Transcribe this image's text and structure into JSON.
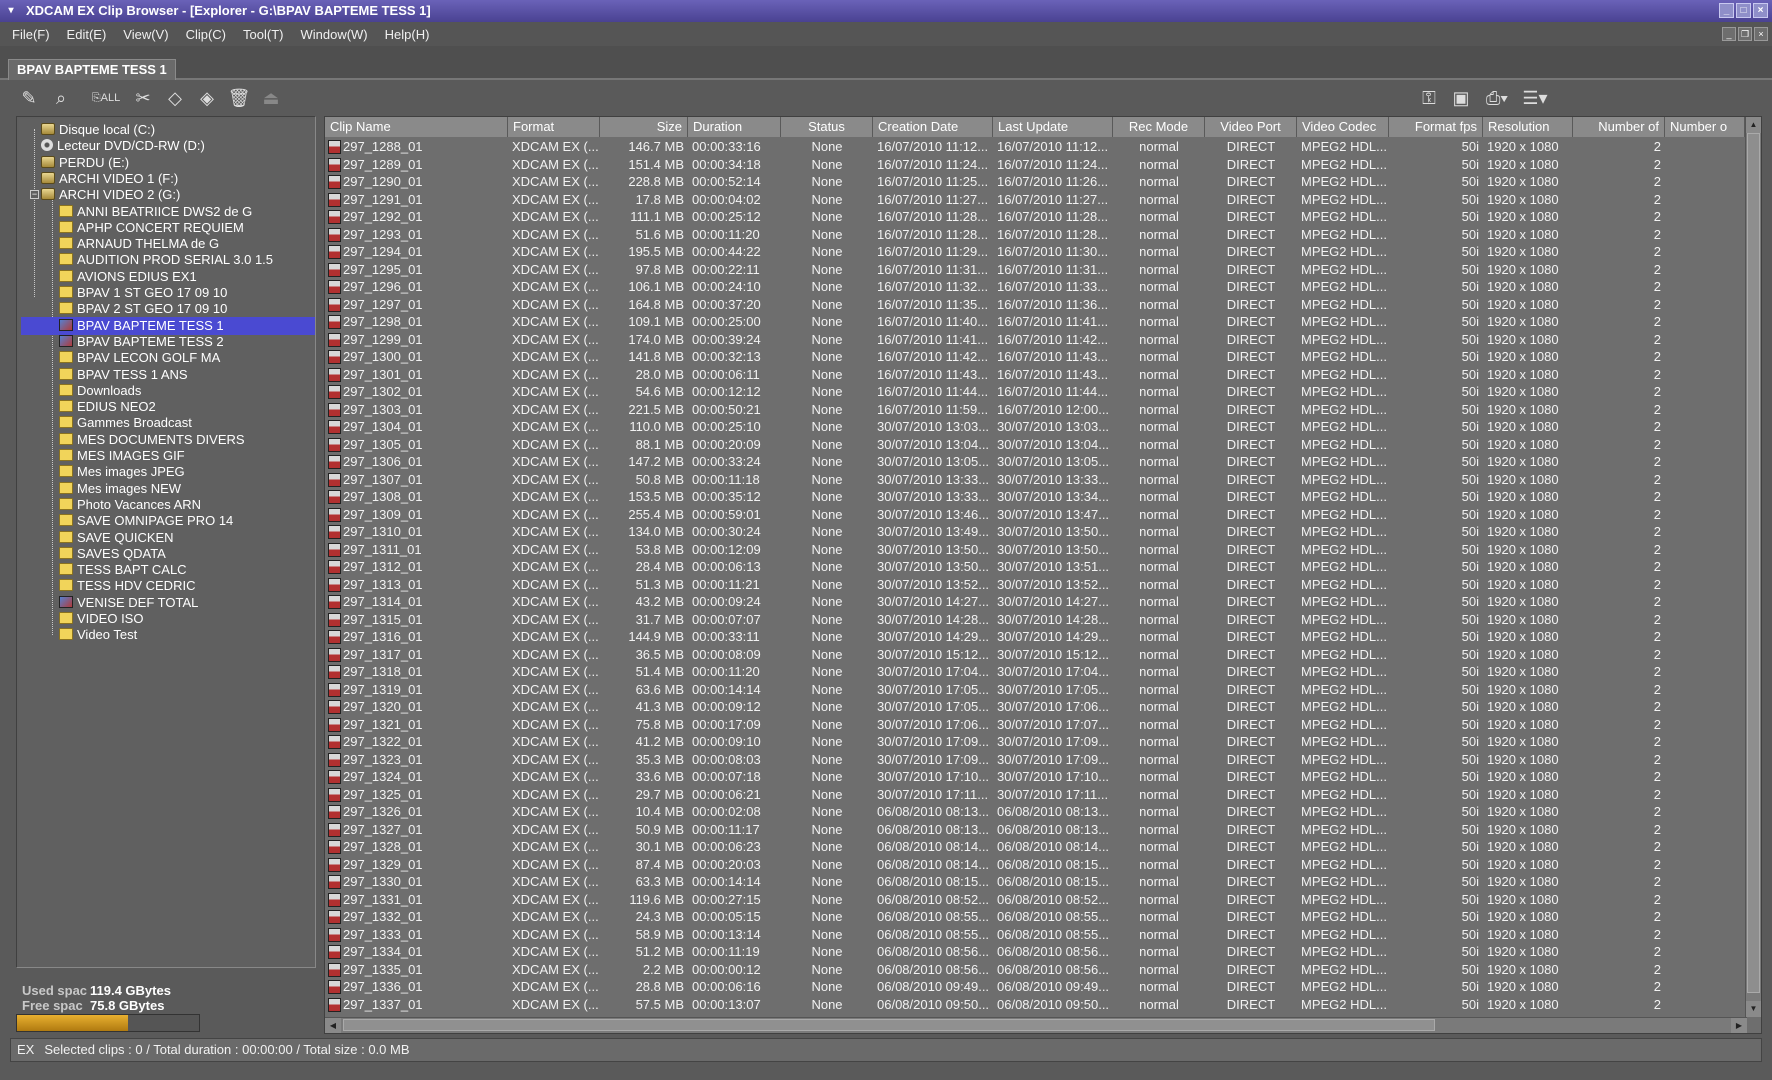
{
  "window": {
    "title": "XDCAM EX Clip Browser - [Explorer - G:\\BPAV BAPTEME TESS 1]"
  },
  "menu": [
    "File(F)",
    "Edit(E)",
    "View(V)",
    "Clip(C)",
    "Tool(T)",
    "Window(W)",
    "Help(H)"
  ],
  "tab": {
    "label": "BPAV BAPTEME TESS 1"
  },
  "tree": [
    {
      "label": "Disque local (C:)",
      "icon": "drive-icon",
      "level": 1
    },
    {
      "label": "Lecteur DVD/CD-RW (D:)",
      "icon": "dvd-icon",
      "level": 1
    },
    {
      "label": "PERDU (E:)",
      "icon": "drive-icon",
      "level": 1
    },
    {
      "label": "ARCHI VIDEO 1 (F:)",
      "icon": "drive-icon",
      "level": 1
    },
    {
      "label": "ARCHI VIDEO 2 (G:)",
      "icon": "drive-icon",
      "level": 1,
      "expanded": true
    },
    {
      "label": "ANNI BEATRIICE DWS2 de G",
      "icon": "folder-icon",
      "level": 2
    },
    {
      "label": "APHP CONCERT REQUIEM",
      "icon": "folder-icon",
      "level": 2
    },
    {
      "label": "ARNAUD THELMA de G",
      "icon": "folder-icon",
      "level": 2
    },
    {
      "label": "AUDITION PROD SERIAL 3.0 1.5",
      "icon": "folder-icon",
      "level": 2
    },
    {
      "label": "AVIONS EDIUS EX1",
      "icon": "folder-icon",
      "level": 2
    },
    {
      "label": "BPAV  1 ST GEO 17 09 10",
      "icon": "folder-icon",
      "level": 2
    },
    {
      "label": "BPAV  2 ST GEO 17 09 10",
      "icon": "folder-icon",
      "level": 2
    },
    {
      "label": "BPAV BAPTEME TESS 1",
      "icon": "clip-folder-icon",
      "level": 2,
      "selected": true
    },
    {
      "label": "BPAV BAPTEME TESS 2",
      "icon": "clip-folder-icon",
      "level": 2
    },
    {
      "label": "BPAV LECON GOLF MA",
      "icon": "folder-icon",
      "level": 2
    },
    {
      "label": "BPAV TESS 1 ANS",
      "icon": "folder-icon",
      "level": 2
    },
    {
      "label": "Downloads",
      "icon": "folder-icon",
      "level": 2
    },
    {
      "label": "EDIUS NEO2",
      "icon": "folder-icon",
      "level": 2
    },
    {
      "label": "Gammes Broadcast",
      "icon": "folder-icon",
      "level": 2
    },
    {
      "label": "MES DOCUMENTS DIVERS",
      "icon": "folder-icon",
      "level": 2
    },
    {
      "label": "MES IMAGES GIF",
      "icon": "folder-icon",
      "level": 2
    },
    {
      "label": "Mes images JPEG",
      "icon": "folder-icon",
      "level": 2
    },
    {
      "label": "Mes images NEW",
      "icon": "folder-icon",
      "level": 2
    },
    {
      "label": "Photo Vacances ARN",
      "icon": "folder-icon",
      "level": 2
    },
    {
      "label": "SAVE OMNIPAGE PRO 14",
      "icon": "folder-icon",
      "level": 2
    },
    {
      "label": "SAVE QUICKEN",
      "icon": "folder-icon",
      "level": 2
    },
    {
      "label": "SAVES QDATA",
      "icon": "folder-icon",
      "level": 2
    },
    {
      "label": "TESS BAPT CALC",
      "icon": "folder-icon",
      "level": 2
    },
    {
      "label": "TESS HDV CEDRIC",
      "icon": "folder-icon",
      "level": 2
    },
    {
      "label": "VENISE DEF TOTAL",
      "icon": "clip-folder-icon",
      "level": 2
    },
    {
      "label": "VIDEO ISO",
      "icon": "folder-icon",
      "level": 2
    },
    {
      "label": "Video Test",
      "icon": "folder-icon",
      "level": 2
    }
  ],
  "disk": {
    "used_label": "Used spac",
    "used_value": "119.4 GBytes",
    "free_label": "Free spac",
    "free_value": "75.8 GBytes",
    "used_fraction": 0.61
  },
  "columns": [
    "Clip Name",
    "Format",
    "Size",
    "Duration",
    "Status",
    "Creation Date",
    "Last Update",
    "Rec Mode",
    "Video Port",
    "Video Codec",
    "Format fps",
    "Resolution",
    "Number of",
    "Number o"
  ],
  "row_constants": {
    "format": "XDCAM EX (...",
    "status": "None",
    "rec_mode": "normal",
    "video_port": "DIRECT",
    "video_codec": "MPEG2 HDL...",
    "fps": "50i",
    "resolution": "1920 x 1080",
    "num_a": "2"
  },
  "rows": [
    [
      "297_1288_01",
      "146.7 MB",
      "00:00:33:16",
      "16/07/2010 11:12...",
      "16/07/2010 11:12..."
    ],
    [
      "297_1289_01",
      "151.4 MB",
      "00:00:34:18",
      "16/07/2010 11:24...",
      "16/07/2010 11:24..."
    ],
    [
      "297_1290_01",
      "228.8 MB",
      "00:00:52:14",
      "16/07/2010 11:25...",
      "16/07/2010 11:26..."
    ],
    [
      "297_1291_01",
      "17.8 MB",
      "00:00:04:02",
      "16/07/2010 11:27...",
      "16/07/2010 11:27..."
    ],
    [
      "297_1292_01",
      "111.1 MB",
      "00:00:25:12",
      "16/07/2010 11:28...",
      "16/07/2010 11:28..."
    ],
    [
      "297_1293_01",
      "51.6 MB",
      "00:00:11:20",
      "16/07/2010 11:28...",
      "16/07/2010 11:28..."
    ],
    [
      "297_1294_01",
      "195.5 MB",
      "00:00:44:22",
      "16/07/2010 11:29...",
      "16/07/2010 11:30..."
    ],
    [
      "297_1295_01",
      "97.8 MB",
      "00:00:22:11",
      "16/07/2010 11:31...",
      "16/07/2010 11:31..."
    ],
    [
      "297_1296_01",
      "106.1 MB",
      "00:00:24:10",
      "16/07/2010 11:32...",
      "16/07/2010 11:33..."
    ],
    [
      "297_1297_01",
      "164.8 MB",
      "00:00:37:20",
      "16/07/2010 11:35...",
      "16/07/2010 11:36..."
    ],
    [
      "297_1298_01",
      "109.1 MB",
      "00:00:25:00",
      "16/07/2010 11:40...",
      "16/07/2010 11:41..."
    ],
    [
      "297_1299_01",
      "174.0 MB",
      "00:00:39:24",
      "16/07/2010 11:41...",
      "16/07/2010 11:42..."
    ],
    [
      "297_1300_01",
      "141.8 MB",
      "00:00:32:13",
      "16/07/2010 11:42...",
      "16/07/2010 11:43..."
    ],
    [
      "297_1301_01",
      "28.0 MB",
      "00:00:06:11",
      "16/07/2010 11:43...",
      "16/07/2010 11:43..."
    ],
    [
      "297_1302_01",
      "54.6 MB",
      "00:00:12:12",
      "16/07/2010 11:44...",
      "16/07/2010 11:44..."
    ],
    [
      "297_1303_01",
      "221.5 MB",
      "00:00:50:21",
      "16/07/2010 11:59...",
      "16/07/2010 12:00..."
    ],
    [
      "297_1304_01",
      "110.0 MB",
      "00:00:25:10",
      "30/07/2010 13:03...",
      "30/07/2010 13:03..."
    ],
    [
      "297_1305_01",
      "88.1 MB",
      "00:00:20:09",
      "30/07/2010 13:04...",
      "30/07/2010 13:04..."
    ],
    [
      "297_1306_01",
      "147.2 MB",
      "00:00:33:24",
      "30/07/2010 13:05...",
      "30/07/2010 13:05..."
    ],
    [
      "297_1307_01",
      "50.8 MB",
      "00:00:11:18",
      "30/07/2010 13:33...",
      "30/07/2010 13:33..."
    ],
    [
      "297_1308_01",
      "153.5 MB",
      "00:00:35:12",
      "30/07/2010 13:33...",
      "30/07/2010 13:34..."
    ],
    [
      "297_1309_01",
      "255.4 MB",
      "00:00:59:01",
      "30/07/2010 13:46...",
      "30/07/2010 13:47..."
    ],
    [
      "297_1310_01",
      "134.0 MB",
      "00:00:30:24",
      "30/07/2010 13:49...",
      "30/07/2010 13:50..."
    ],
    [
      "297_1311_01",
      "53.8 MB",
      "00:00:12:09",
      "30/07/2010 13:50...",
      "30/07/2010 13:50..."
    ],
    [
      "297_1312_01",
      "28.4 MB",
      "00:00:06:13",
      "30/07/2010 13:50...",
      "30/07/2010 13:51..."
    ],
    [
      "297_1313_01",
      "51.3 MB",
      "00:00:11:21",
      "30/07/2010 13:52...",
      "30/07/2010 13:52..."
    ],
    [
      "297_1314_01",
      "43.2 MB",
      "00:00:09:24",
      "30/07/2010 14:27...",
      "30/07/2010 14:27..."
    ],
    [
      "297_1315_01",
      "31.7 MB",
      "00:00:07:07",
      "30/07/2010 14:28...",
      "30/07/2010 14:28..."
    ],
    [
      "297_1316_01",
      "144.9 MB",
      "00:00:33:11",
      "30/07/2010 14:29...",
      "30/07/2010 14:29..."
    ],
    [
      "297_1317_01",
      "36.5 MB",
      "00:00:08:09",
      "30/07/2010 15:12...",
      "30/07/2010 15:12..."
    ],
    [
      "297_1318_01",
      "51.4 MB",
      "00:00:11:20",
      "30/07/2010 17:04...",
      "30/07/2010 17:04..."
    ],
    [
      "297_1319_01",
      "63.6 MB",
      "00:00:14:14",
      "30/07/2010 17:05...",
      "30/07/2010 17:05..."
    ],
    [
      "297_1320_01",
      "41.3 MB",
      "00:00:09:12",
      "30/07/2010 17:05...",
      "30/07/2010 17:06..."
    ],
    [
      "297_1321_01",
      "75.8 MB",
      "00:00:17:09",
      "30/07/2010 17:06...",
      "30/07/2010 17:07..."
    ],
    [
      "297_1322_01",
      "41.2 MB",
      "00:00:09:10",
      "30/07/2010 17:09...",
      "30/07/2010 17:09..."
    ],
    [
      "297_1323_01",
      "35.3 MB",
      "00:00:08:03",
      "30/07/2010 17:09...",
      "30/07/2010 17:09..."
    ],
    [
      "297_1324_01",
      "33.6 MB",
      "00:00:07:18",
      "30/07/2010 17:10...",
      "30/07/2010 17:10..."
    ],
    [
      "297_1325_01",
      "29.7 MB",
      "00:00:06:21",
      "30/07/2010 17:11...",
      "30/07/2010 17:11..."
    ],
    [
      "297_1326_01",
      "10.4 MB",
      "00:00:02:08",
      "06/08/2010 08:13...",
      "06/08/2010 08:13..."
    ],
    [
      "297_1327_01",
      "50.9 MB",
      "00:00:11:17",
      "06/08/2010 08:13...",
      "06/08/2010 08:13..."
    ],
    [
      "297_1328_01",
      "30.1 MB",
      "00:00:06:23",
      "06/08/2010 08:14...",
      "06/08/2010 08:14..."
    ],
    [
      "297_1329_01",
      "87.4 MB",
      "00:00:20:03",
      "06/08/2010 08:14...",
      "06/08/2010 08:15..."
    ],
    [
      "297_1330_01",
      "63.3 MB",
      "00:00:14:14",
      "06/08/2010 08:15...",
      "06/08/2010 08:15..."
    ],
    [
      "297_1331_01",
      "119.6 MB",
      "00:00:27:15",
      "06/08/2010 08:52...",
      "06/08/2010 08:52..."
    ],
    [
      "297_1332_01",
      "24.3 MB",
      "00:00:05:15",
      "06/08/2010 08:55...",
      "06/08/2010 08:55..."
    ],
    [
      "297_1333_01",
      "58.9 MB",
      "00:00:13:14",
      "06/08/2010 08:55...",
      "06/08/2010 08:55..."
    ],
    [
      "297_1334_01",
      "51.2 MB",
      "00:00:11:19",
      "06/08/2010 08:56...",
      "06/08/2010 08:56..."
    ],
    [
      "297_1335_01",
      "2.2 MB",
      "00:00:00:12",
      "06/08/2010 08:56...",
      "06/08/2010 08:56..."
    ],
    [
      "297_1336_01",
      "28.8 MB",
      "00:00:06:16",
      "06/08/2010 09:49...",
      "06/08/2010 09:49..."
    ],
    [
      "297_1337_01",
      "57.5 MB",
      "00:00:13:07",
      "06/08/2010 09:50...",
      "06/08/2010 09:50..."
    ]
  ],
  "status": {
    "prefix": "EX",
    "text": "Selected clips : 0 / Total duration : 00:00:00 / Total size : 0.0 MB"
  },
  "colors": {
    "title_bar": "#5a52a8",
    "selection": "#4a4ad2",
    "meter": "#e0a020"
  }
}
